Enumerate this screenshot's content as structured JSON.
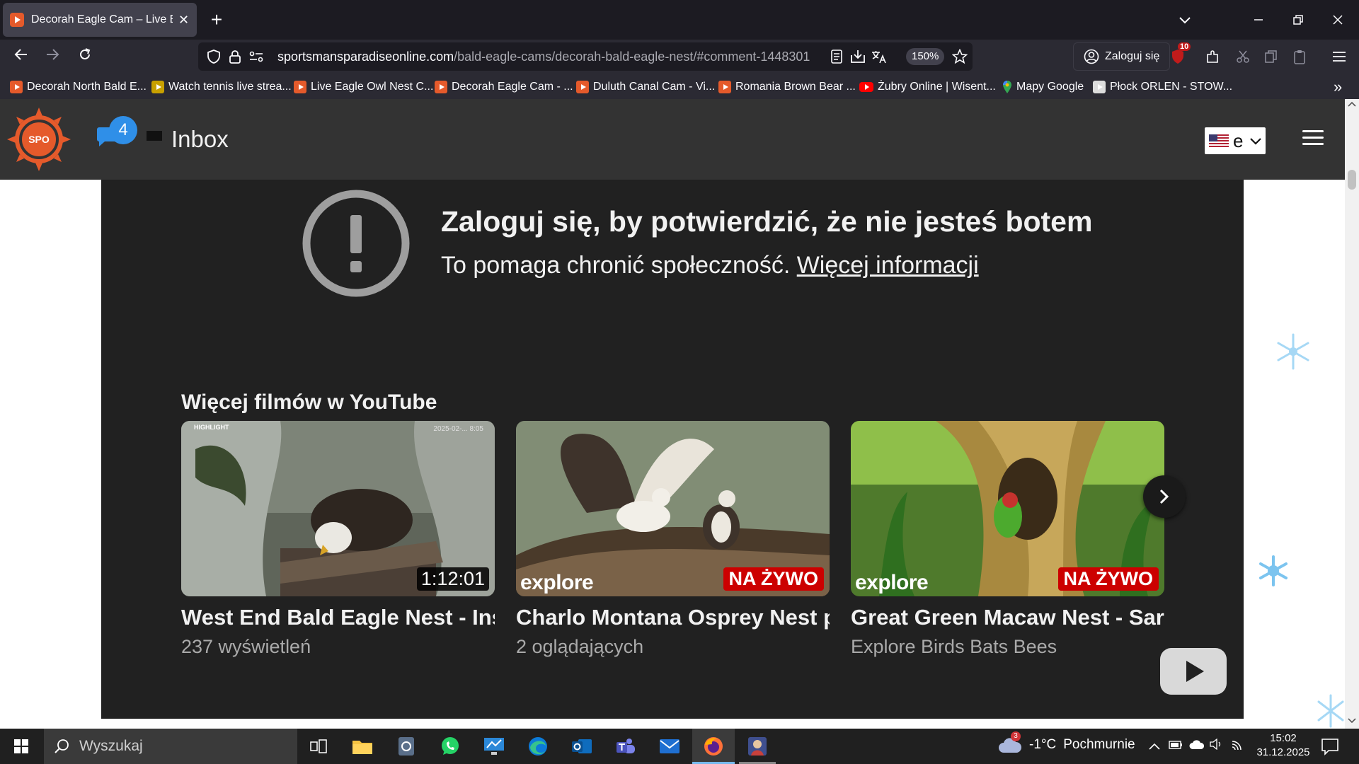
{
  "browser": {
    "tab": {
      "title": "Decorah Eagle Cam – Live Bald",
      "close_glyph": "✕"
    },
    "new_tab_glyph": "+",
    "url": {
      "domain": "sportsmansparadiseonline.com",
      "path": "/bald-eagle-cams/decorah-bald-eagle-nest/#comment-1448301"
    },
    "zoom": "150%",
    "login_button": "Zaloguj się",
    "extension_badge_count": "10",
    "bookmarks": [
      "Decorah North Bald E...",
      "Watch tennis live strea...",
      "Live Eagle Owl Nest C...",
      "Decorah Eagle Cam - ...",
      "Duluth Canal Cam - Vi...",
      "Romania Brown Bear ...",
      "Żubry Online | Wisent...",
      "Mapy Google",
      "Płock ORLEN - STOW..."
    ],
    "more_bookmarks_glyph": "»"
  },
  "site": {
    "notification_count": "4",
    "inbox_label": "Inbox",
    "language_value": "e"
  },
  "embed": {
    "warning_title": "Zaloguj się, by potwierdzić, że nie jesteś botem",
    "warning_text": "To pomaga chronić społeczność.",
    "warning_link": "Więcej informacji",
    "more_videos_heading": "Więcej filmów w YouTube",
    "videos": [
      {
        "title": "West End Bald Eagle Nest - Inst...",
        "meta": "237 wyświetleń",
        "badge": "1:12:01",
        "tag": "HIGHLIGHT",
        "overlay_date": "2025-02-... 8:05"
      },
      {
        "title": "Charlo Montana Osprey Nest p...",
        "meta": "2 oglądających",
        "badge": "NA ŻYWO",
        "channel_logo": "explore"
      },
      {
        "title": "Great Green Macaw Nest - Sara...",
        "meta": "Explore Birds Bats Bees",
        "badge": "NA ŻYWO",
        "channel_logo": "explore"
      }
    ]
  },
  "taskbar": {
    "search_placeholder": "Wyszukaj",
    "weather": {
      "temperature": "-1°C",
      "condition": "Pochmurnie",
      "alert_count": "3"
    },
    "clock": {
      "time": "15:02",
      "date": "31.12.2025"
    }
  },
  "colors": {
    "browser_bg": "#1c1b22",
    "site_header": "#333333",
    "embed_bg": "#212121",
    "live_red": "#cc0000",
    "notification_blue": "#2f8fe8",
    "brand_orange": "#e55a2b"
  }
}
